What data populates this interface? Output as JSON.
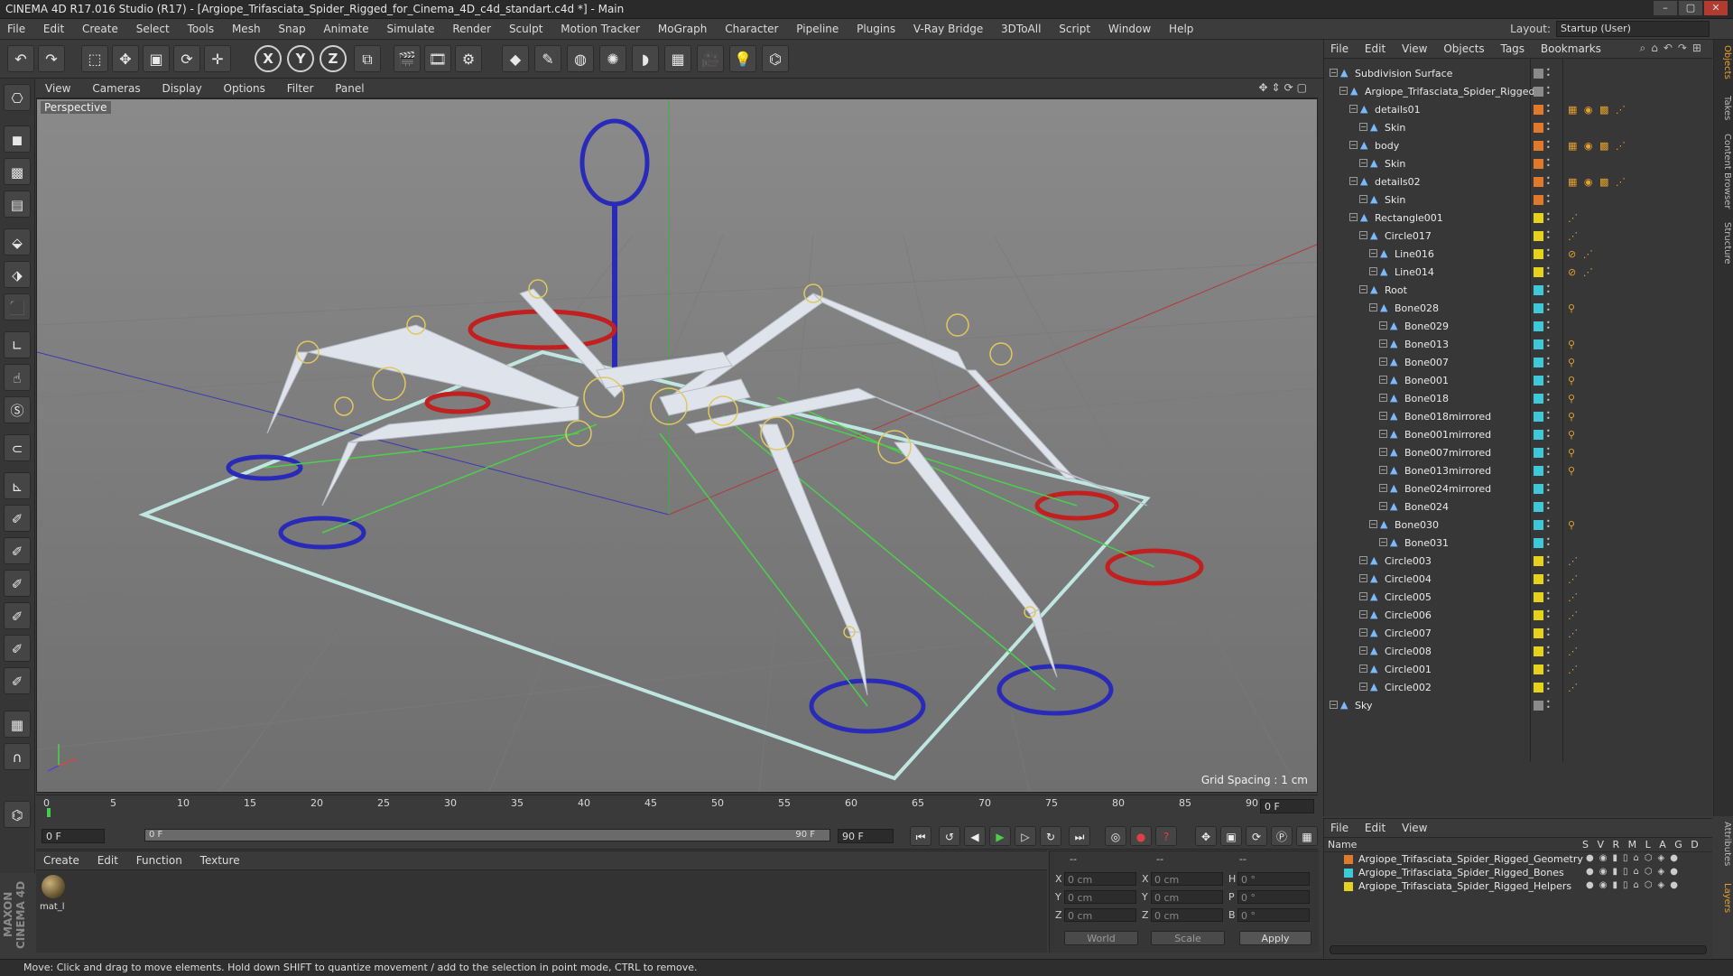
{
  "window": {
    "title": "CINEMA 4D R17.016 Studio (R17) - [Argiope_Trifasciata_Spider_Rigged_for_Cinema_4D_c4d_standart.c4d *] - Main",
    "controls": [
      "–",
      "▢",
      "✕"
    ]
  },
  "menubar": {
    "items": [
      "File",
      "Edit",
      "Create",
      "Select",
      "Tools",
      "Mesh",
      "Snap",
      "Animate",
      "Simulate",
      "Render",
      "Sculpt",
      "Motion Tracker",
      "MoGraph",
      "Character",
      "Pipeline",
      "Plugins",
      "V-Ray Bridge",
      "3DToAll",
      "Script",
      "Window",
      "Help"
    ],
    "layout_label": "Layout:",
    "layout_value": "Startup (User)"
  },
  "toolbar": {
    "axis_x": "X",
    "axis_y": "Y",
    "axis_z": "Z"
  },
  "viewport": {
    "menu": [
      "View",
      "Cameras",
      "Display",
      "Options",
      "Filter",
      "Panel"
    ],
    "label": "Perspective",
    "grid_spacing": "Grid Spacing : 1 cm"
  },
  "timeline": {
    "ticks": [
      "0",
      "5",
      "10",
      "15",
      "20",
      "25",
      "30",
      "35",
      "40",
      "45",
      "50",
      "55",
      "60",
      "65",
      "70",
      "75",
      "80",
      "85",
      "90"
    ],
    "current_frame": "0 F",
    "start_field": "0 F",
    "slider_start": "0 F",
    "slider_end": "90 F",
    "end_field": "90 F"
  },
  "material_panel": {
    "menu": [
      "Create",
      "Edit",
      "Function",
      "Texture"
    ],
    "material_name": "mat_l"
  },
  "coordinates": {
    "headers": [
      "--",
      "--",
      "--"
    ],
    "rows": [
      {
        "a": "X",
        "av": "0 cm",
        "b": "X",
        "bv": "0 cm",
        "c": "H",
        "cv": "0 °"
      },
      {
        "a": "Y",
        "av": "0 cm",
        "b": "Y",
        "bv": "0 cm",
        "c": "P",
        "cv": "0 °"
      },
      {
        "a": "Z",
        "av": "0 cm",
        "b": "Z",
        "bv": "0 cm",
        "c": "B",
        "cv": "0 °"
      }
    ],
    "world": "World",
    "scale": "Scale",
    "apply": "Apply"
  },
  "status": {
    "message": "Move: Click and drag to move elements. Hold down SHIFT to quantize movement / add to the selection in point mode, CTRL to remove."
  },
  "brand": "MAXON CINEMA 4D",
  "object_manager": {
    "menu": [
      "File",
      "Edit",
      "View",
      "Objects",
      "Tags",
      "Bookmarks"
    ],
    "items": [
      {
        "name": "Subdivision Surface",
        "depth": 0,
        "layer": "#8a8a8a",
        "tags": ""
      },
      {
        "name": "Argiope_Trifasciata_Spider_Rigged",
        "depth": 1,
        "layer": "#8a8a8a",
        "tags": ""
      },
      {
        "name": "details01",
        "depth": 2,
        "layer": "#e07a2a",
        "tags": "▦ ◉ ▩ ⋰"
      },
      {
        "name": "Skin",
        "depth": 3,
        "layer": "#e07a2a",
        "tags": ""
      },
      {
        "name": "body",
        "depth": 2,
        "layer": "#e07a2a",
        "tags": "▦ ◉ ▩ ⋰"
      },
      {
        "name": "Skin",
        "depth": 3,
        "layer": "#e07a2a",
        "tags": ""
      },
      {
        "name": "details02",
        "depth": 2,
        "layer": "#e07a2a",
        "tags": "▦ ◉ ▩ ⋰"
      },
      {
        "name": "Skin",
        "depth": 3,
        "layer": "#e07a2a",
        "tags": ""
      },
      {
        "name": "Rectangle001",
        "depth": 2,
        "layer": "#e5d21c",
        "tags": "⋰"
      },
      {
        "name": "Circle017",
        "depth": 3,
        "layer": "#e5d21c",
        "tags": "⋰"
      },
      {
        "name": "Line016",
        "depth": 4,
        "layer": "#e5d21c",
        "tags": "⊘ ⋰"
      },
      {
        "name": "Line014",
        "depth": 4,
        "layer": "#e5d21c",
        "tags": "⊘ ⋰"
      },
      {
        "name": "Root",
        "depth": 3,
        "layer": "#3fc8d8",
        "tags": ""
      },
      {
        "name": "Bone028",
        "depth": 4,
        "layer": "#3fc8d8",
        "tags": "⚲"
      },
      {
        "name": "Bone029",
        "depth": 5,
        "layer": "#3fc8d8",
        "tags": ""
      },
      {
        "name": "Bone013",
        "depth": 5,
        "layer": "#3fc8d8",
        "tags": "⚲"
      },
      {
        "name": "Bone007",
        "depth": 5,
        "layer": "#3fc8d8",
        "tags": "⚲"
      },
      {
        "name": "Bone001",
        "depth": 5,
        "layer": "#3fc8d8",
        "tags": "⚲"
      },
      {
        "name": "Bone018",
        "depth": 5,
        "layer": "#3fc8d8",
        "tags": "⚲"
      },
      {
        "name": "Bone018mirrored",
        "depth": 5,
        "layer": "#3fc8d8",
        "tags": "⚲"
      },
      {
        "name": "Bone001mirrored",
        "depth": 5,
        "layer": "#3fc8d8",
        "tags": "⚲"
      },
      {
        "name": "Bone007mirrored",
        "depth": 5,
        "layer": "#3fc8d8",
        "tags": "⚲"
      },
      {
        "name": "Bone013mirrored",
        "depth": 5,
        "layer": "#3fc8d8",
        "tags": "⚲"
      },
      {
        "name": "Bone024mirrored",
        "depth": 5,
        "layer": "#3fc8d8",
        "tags": ""
      },
      {
        "name": "Bone024",
        "depth": 5,
        "layer": "#3fc8d8",
        "tags": ""
      },
      {
        "name": "Bone030",
        "depth": 4,
        "layer": "#3fc8d8",
        "tags": "⚲"
      },
      {
        "name": "Bone031",
        "depth": 5,
        "layer": "#3fc8d8",
        "tags": ""
      },
      {
        "name": "Circle003",
        "depth": 3,
        "layer": "#e5d21c",
        "tags": "⋰"
      },
      {
        "name": "Circle004",
        "depth": 3,
        "layer": "#e5d21c",
        "tags": "⋰"
      },
      {
        "name": "Circle005",
        "depth": 3,
        "layer": "#e5d21c",
        "tags": "⋰"
      },
      {
        "name": "Circle006",
        "depth": 3,
        "layer": "#e5d21c",
        "tags": "⋰"
      },
      {
        "name": "Circle007",
        "depth": 3,
        "layer": "#e5d21c",
        "tags": "⋰"
      },
      {
        "name": "Circle008",
        "depth": 3,
        "layer": "#e5d21c",
        "tags": "⋰"
      },
      {
        "name": "Circle001",
        "depth": 3,
        "layer": "#e5d21c",
        "tags": "⋰"
      },
      {
        "name": "Circle002",
        "depth": 3,
        "layer": "#e5d21c",
        "tags": "⋰"
      },
      {
        "name": "Sky",
        "depth": 0,
        "layer": "#8a8a8a",
        "tags": ""
      }
    ]
  },
  "side_tabs": [
    "Objects",
    "Takes",
    "Content Browser",
    "Structure"
  ],
  "side_tabs_lower": [
    "Attributes",
    "Layers"
  ],
  "layer_manager": {
    "menu": [
      "File",
      "Edit",
      "View"
    ],
    "name_header": "Name",
    "flags_header": "S V R M L A G D",
    "layers": [
      {
        "name": "Argiope_Trifasciata_Spider_Rigged_Geometry",
        "color": "#e07a2a"
      },
      {
        "name": "Argiope_Trifasciata_Spider_Rigged_Bones",
        "color": "#3fc8d8"
      },
      {
        "name": "Argiope_Trifasciata_Spider_Rigged_Helpers",
        "color": "#e5d21c"
      }
    ]
  }
}
